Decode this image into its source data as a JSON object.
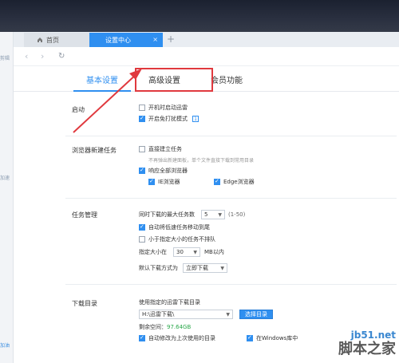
{
  "left_panel": {
    "top_text": "剪辑",
    "mid_text": "加速",
    "bottom_text": "加油"
  },
  "browser": {
    "tabs": [
      {
        "label": "首页"
      },
      {
        "label": "设置中心",
        "close": "×"
      }
    ],
    "add_tab": "+",
    "nav": {
      "back": "‹",
      "forward": "›",
      "refresh": "↻"
    }
  },
  "settings_tabs": [
    "基本设置",
    "高级设置",
    "会员功能"
  ],
  "startup": {
    "label": "启动",
    "options": [
      {
        "text": "开机时启动迅雷",
        "checked": false
      },
      {
        "text": "开启免打扰模式",
        "checked": true,
        "badge": "1"
      }
    ]
  },
  "browser_task": {
    "label": "浏览器新建任务",
    "direct": {
      "text": "直接建立任务",
      "checked": false
    },
    "direct_hint": "不再弹出新建面板，单个文件直接下载到常用目录",
    "respond_all": {
      "text": "响应全部浏览器",
      "checked": true
    },
    "ie": {
      "text": "IE浏览器",
      "checked": true
    },
    "edge": {
      "text": "Edge浏览器",
      "checked": true
    }
  },
  "task_mgmt": {
    "label": "任务管理",
    "max_tasks_label": "同时下载的最大任务数",
    "max_tasks_value": "5",
    "max_tasks_range": "(1-50)",
    "auto_move": {
      "text": "自动将低速任务移动到尾",
      "checked": true
    },
    "small_first": {
      "text": "小于指定大小的任务不排队",
      "checked": false
    },
    "size_label": "指定大小在",
    "size_value": "30",
    "size_unit": "MB以内",
    "default_mode_label": "默认下载方式为",
    "default_mode_value": "立即下载"
  },
  "download_dir": {
    "label": "下载目录",
    "use_label": "使用指定的迅雷下载目录",
    "path": "H:\\迅雷下载\\",
    "choose_button": "选择目录",
    "free_label": "剩余空间：",
    "free_value": "97.64GB",
    "auto_modify": {
      "text": "自动修改为上次使用的目录",
      "checked": true
    },
    "windows_lib": {
      "text": "在Windows库中",
      "checked": true
    }
  },
  "watermark": {
    "site": "jb51.net",
    "name": "脚本之家"
  },
  "colors": {
    "accent": "#2f8ff0",
    "highlight": "#e0393e",
    "free_space": "#2aa84a"
  }
}
